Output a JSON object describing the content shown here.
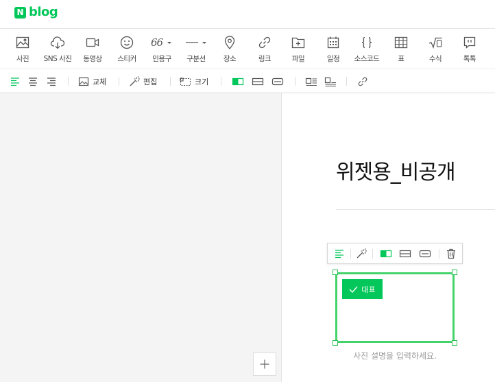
{
  "header": {
    "logo_mark": "N",
    "logo_text": "blog"
  },
  "toolbar": {
    "items": [
      {
        "label": "사진",
        "icon": "photo-icon"
      },
      {
        "label": "SNS 사진",
        "icon": "cloud-download-icon"
      },
      {
        "label": "동영상",
        "icon": "video-camera-icon"
      },
      {
        "label": "스티커",
        "icon": "smiley-icon"
      },
      {
        "label": "인용구",
        "icon": "quote-icon"
      },
      {
        "label": "구분선",
        "icon": "divider-line-icon"
      },
      {
        "label": "장소",
        "icon": "map-pin-icon"
      },
      {
        "label": "링크",
        "icon": "link-icon"
      },
      {
        "label": "파일",
        "icon": "folder-plus-icon"
      },
      {
        "label": "일정",
        "icon": "calendar-icon"
      },
      {
        "label": "소스코드",
        "icon": "curly-braces-icon"
      },
      {
        "label": "표",
        "icon": "table-icon"
      },
      {
        "label": "수식",
        "icon": "square-root-icon"
      },
      {
        "label": "톡톡",
        "icon": "chat-bubble-icon"
      }
    ],
    "quote_glyph": "66"
  },
  "toolbar2": {
    "replace_label": "교체",
    "edit_label": "편집",
    "size_label": "크기"
  },
  "document": {
    "title": "위젯용_비공개",
    "representative_label": "대표",
    "caption_placeholder": "사진 설명을 입력하세요."
  },
  "colors": {
    "accent": "#03c75a",
    "selection": "#43d36a"
  }
}
